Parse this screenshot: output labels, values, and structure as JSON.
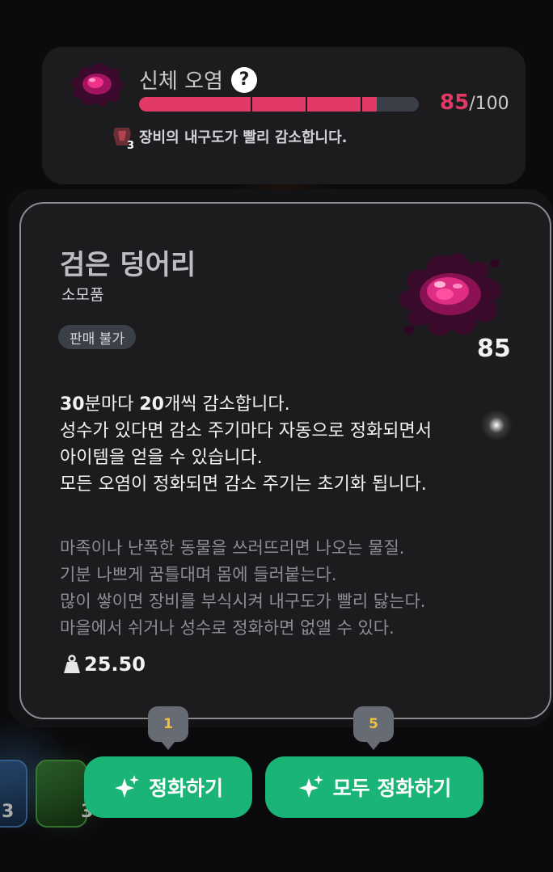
{
  "status": {
    "title": "신체 오염",
    "help_icon": "question-icon",
    "current": "85",
    "max": "/100",
    "progress": 0.85,
    "effect_level": "3",
    "effect_text": "장비의 내구도가 빨리 감소합니다."
  },
  "item": {
    "name": "검은 덩어리",
    "type": "소모품",
    "tag": "판매 불가",
    "count": "85",
    "desc": {
      "line1_num1": "30",
      "line1_mid": "분마다 ",
      "line1_num2": "20",
      "line1_end": "개씩 감소합니다.",
      "line2": "성수가 있다면 감소 주기마다 자동으로 정화되면서",
      "line3": "아이템을 얻을 수 있습니다.",
      "line4": "모든 오염이 정화되면 감소 주기는 초기화 됩니다."
    },
    "lore": [
      "마족이나 난폭한 동물을 쓰러뜨리면 나오는 물질.",
      "기분 나쁘게 꿈틀대며 몸에 들러붙는다.",
      "많이 쌓이면 장비를 부식시켜 내구도가 빨리 닳는다.",
      "마을에서 쉬거나 성수로 정화하면 없앨 수 있다."
    ],
    "weight": "25.50"
  },
  "actions": {
    "purify_badge": "1",
    "purify_label": "정화하기",
    "purify_all_badge": "5",
    "purify_all_label": "모두 정화하기"
  },
  "side": {
    "num1": "3",
    "num2": "3"
  },
  "colors": {
    "accent_pink": "#e23a67",
    "button_green": "#1bb477",
    "badge_gold": "#f0c040"
  }
}
